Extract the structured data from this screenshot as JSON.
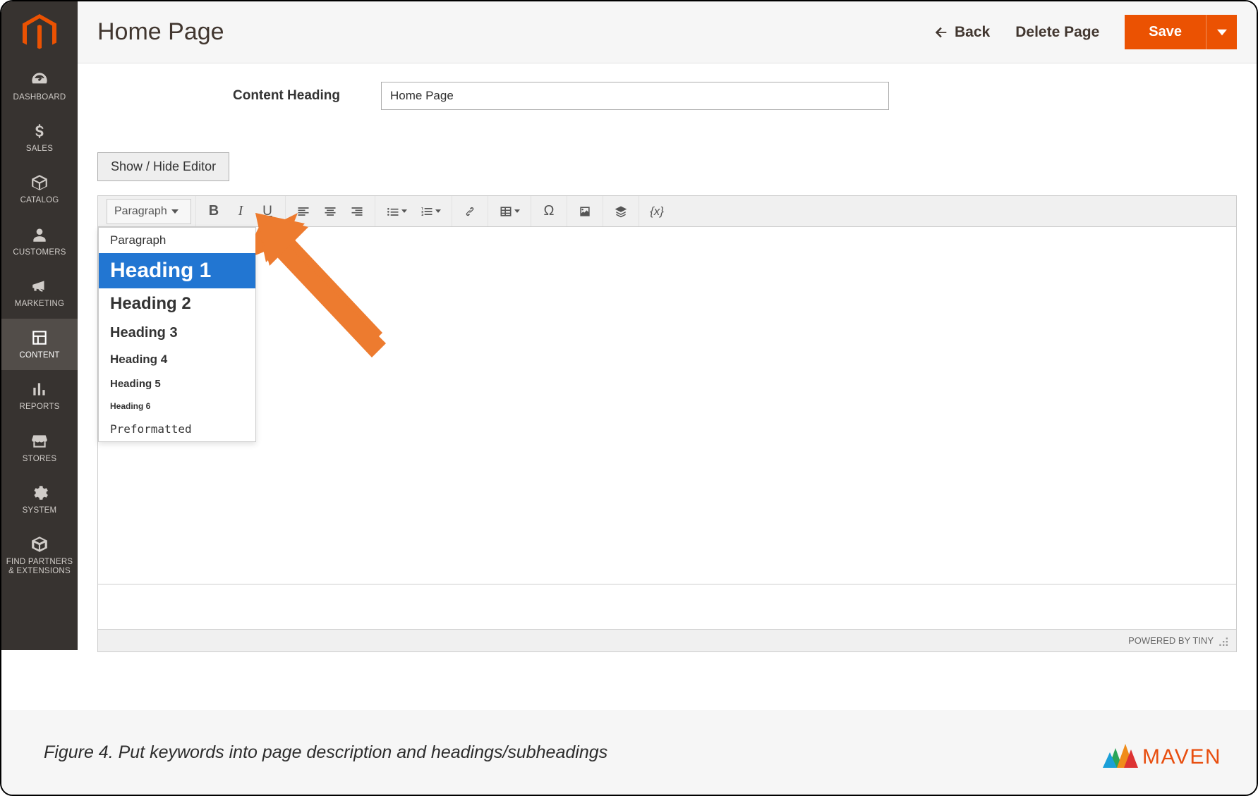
{
  "header": {
    "page_title": "Home Page",
    "back_label": "Back",
    "delete_label": "Delete Page",
    "save_label": "Save"
  },
  "sidebar": {
    "items": [
      {
        "label": "DASHBOARD"
      },
      {
        "label": "SALES"
      },
      {
        "label": "CATALOG"
      },
      {
        "label": "CUSTOMERS"
      },
      {
        "label": "MARKETING"
      },
      {
        "label": "CONTENT"
      },
      {
        "label": "REPORTS"
      },
      {
        "label": "STORES"
      },
      {
        "label": "SYSTEM"
      },
      {
        "label": "FIND PARTNERS & EXTENSIONS"
      }
    ],
    "active_index": 5
  },
  "form": {
    "content_heading_label": "Content Heading",
    "content_heading_value": "Home Page"
  },
  "editor": {
    "toggle_label": "Show / Hide Editor",
    "format_current": "Paragraph",
    "format_options": [
      "Paragraph",
      "Heading 1",
      "Heading 2",
      "Heading 3",
      "Heading 4",
      "Heading 5",
      "Heading 6",
      "Preformatted"
    ],
    "format_selected_index": 1,
    "footer": "POWERED BY TINY",
    "toolbar_icons": [
      "bold",
      "italic",
      "underline",
      "align-left",
      "align-center",
      "align-right",
      "bullet-list",
      "number-list",
      "link",
      "table",
      "special-char",
      "image",
      "widget",
      "variable"
    ]
  },
  "caption": "Figure 4. Put keywords into page description and headings/subheadings",
  "brand": "maven",
  "colors": {
    "accent": "#eb5202",
    "sidebar_bg": "#373330",
    "dropdown_highlight": "#2276d2"
  }
}
